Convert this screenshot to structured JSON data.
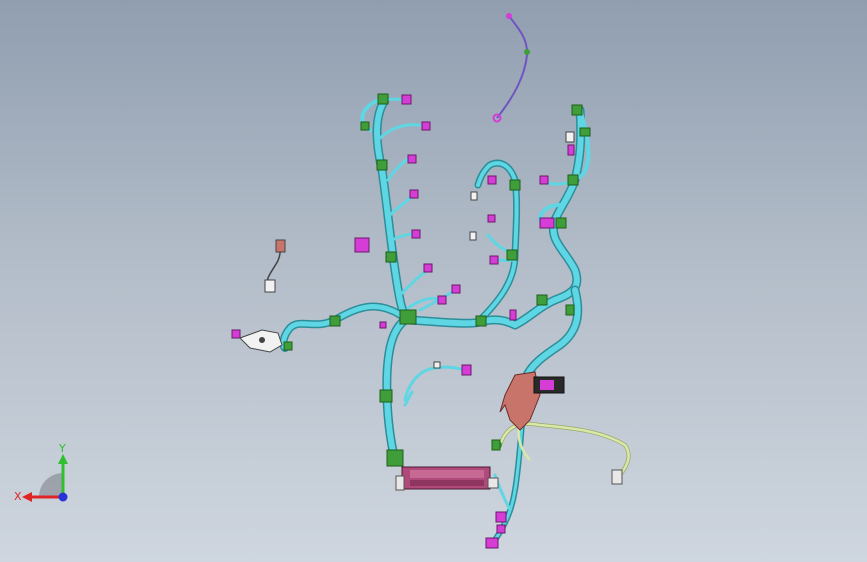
{
  "viewport": {
    "background_top": "#909eb0",
    "background_bottom": "#cfd6df"
  },
  "model": {
    "description_colors": {
      "harness": "#5fd6e3",
      "harness_outline": "#2c8e99",
      "clip": "#3f9e3a",
      "connector": "#d63cd6",
      "bracket": "#c9746a",
      "ecu": "#b04a7a",
      "ground_wire": "#d8e8a8",
      "thin_wire": "#6f55c2"
    }
  },
  "triad": {
    "x_label": "X",
    "y_label": "Y",
    "x_color": "#e02424",
    "y_color": "#2fbf2f",
    "z_color": "#2633d8"
  }
}
